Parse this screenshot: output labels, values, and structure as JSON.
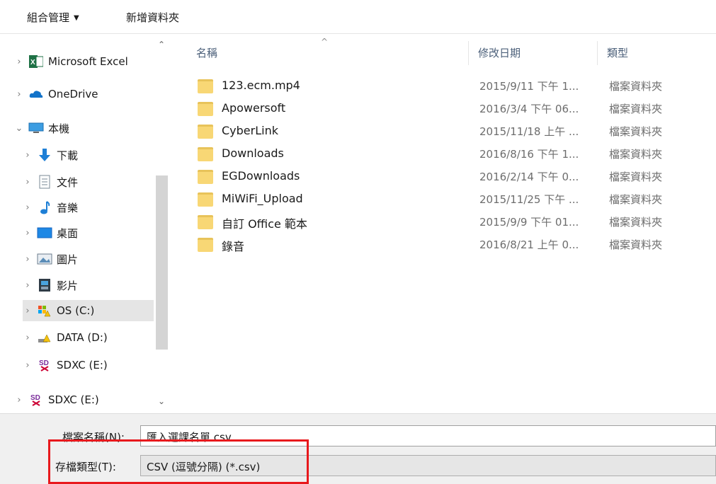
{
  "toolbar": {
    "organize_label": "組合管理",
    "organize_caret": "▼",
    "new_folder_label": "新增資料夾"
  },
  "nav": {
    "scroll_up": "⌃",
    "scroll_down": "⌄",
    "items": [
      {
        "label": "Microsoft Excel",
        "chevron": "›",
        "icon": "excel-icon"
      },
      {
        "label": "OneDrive",
        "chevron": "›",
        "icon": "onedrive-icon"
      },
      {
        "label": "本機",
        "chevron": "⌄",
        "icon": "this-pc-icon"
      },
      {
        "label": "下載",
        "chevron": "›",
        "icon": "downloads-icon"
      },
      {
        "label": "文件",
        "chevron": "›",
        "icon": "documents-icon"
      },
      {
        "label": "音樂",
        "chevron": "›",
        "icon": "music-icon"
      },
      {
        "label": "桌面",
        "chevron": "›",
        "icon": "desktop-icon"
      },
      {
        "label": "圖片",
        "chevron": "›",
        "icon": "pictures-icon"
      },
      {
        "label": "影片",
        "chevron": "›",
        "icon": "videos-icon"
      },
      {
        "label": "OS (C:)",
        "chevron": "›",
        "icon": "drive-c-icon"
      },
      {
        "label": "DATA (D:)",
        "chevron": "›",
        "icon": "drive-d-icon"
      },
      {
        "label": "SDXC (E:)",
        "chevron": "›",
        "icon": "sd-card-icon"
      },
      {
        "label": "SDXC (E:)",
        "chevron": "›",
        "icon": "sd-card-icon"
      }
    ]
  },
  "list": {
    "sort_indicator": "^",
    "columns": {
      "name": "名稱",
      "date": "修改日期",
      "type": "類型"
    },
    "rows": [
      {
        "name": "123.ecm.mp4",
        "date": "2015/9/11 下午 1...",
        "type": "檔案資料夾"
      },
      {
        "name": "Apowersoft",
        "date": "2016/3/4 下午 06...",
        "type": "檔案資料夾"
      },
      {
        "name": "CyberLink",
        "date": "2015/11/18 上午 ...",
        "type": "檔案資料夾"
      },
      {
        "name": "Downloads",
        "date": "2016/8/16 下午 1...",
        "type": "檔案資料夾"
      },
      {
        "name": "EGDownloads",
        "date": "2016/2/14 下午 0...",
        "type": "檔案資料夾"
      },
      {
        "name": "MiWiFi_Upload",
        "date": "2015/11/25 下午 ...",
        "type": "檔案資料夾"
      },
      {
        "name": "自訂 Office 範本",
        "date": "2015/9/9 下午 01...",
        "type": "檔案資料夾"
      },
      {
        "name": "錄音",
        "date": "2016/8/21 上午 0...",
        "type": "檔案資料夾"
      }
    ]
  },
  "form": {
    "filename_label": "檔案名稱(N):",
    "filename_value": "匯入選課名單.csv",
    "filetype_label": "存檔類型(T):",
    "filetype_value": "CSV (逗號分隔) (*.csv)"
  },
  "colors": {
    "highlight": "#e8191d",
    "folder": "#f8d775",
    "selected_bg": "#e5e5e5"
  }
}
